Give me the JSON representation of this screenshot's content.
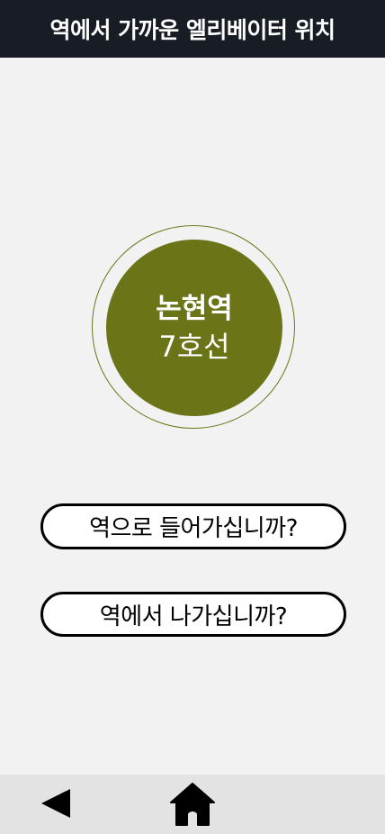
{
  "header": {
    "title": "역에서 가까운 엘리베이터 위치"
  },
  "station": {
    "name": "논현역",
    "line": "7호선",
    "line_color": "#6b7417"
  },
  "actions": {
    "enter_label": "역으로 들어가십니까?",
    "exit_label": "역에서 나가십니까?"
  },
  "nav": {
    "back_icon": "back-triangle-icon",
    "home_icon": "home-icon"
  }
}
